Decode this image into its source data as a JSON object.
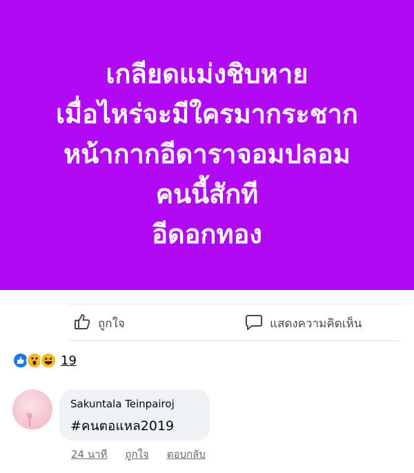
{
  "post": {
    "banner_color": "#b109f3",
    "lines": [
      "เกลียดแม่งชิบหาย",
      "เมื่อไหร่จะมีใครมากระชาก",
      "หน้ากากอีดาราจอมปลอม",
      "คนนี้สักที",
      "อีดอกทอง"
    ]
  },
  "actions": {
    "like_label": "ถูกใจ",
    "like_icon": "thumbs-up-icon",
    "comment_label": "แสดงความคิดเห็น",
    "comment_icon": "comment-bubble-icon"
  },
  "reactions": {
    "icons": [
      "like-reaction-icon",
      "wow-reaction-icon",
      "haha-reaction-icon"
    ],
    "count": "19"
  },
  "comment": {
    "author": "Sakuntala Teinpairoj",
    "text": "#คนตอแหล2019",
    "time": "24 นาที",
    "like_label": "ถูกใจ",
    "reply_label": "ตอบกลับ"
  }
}
